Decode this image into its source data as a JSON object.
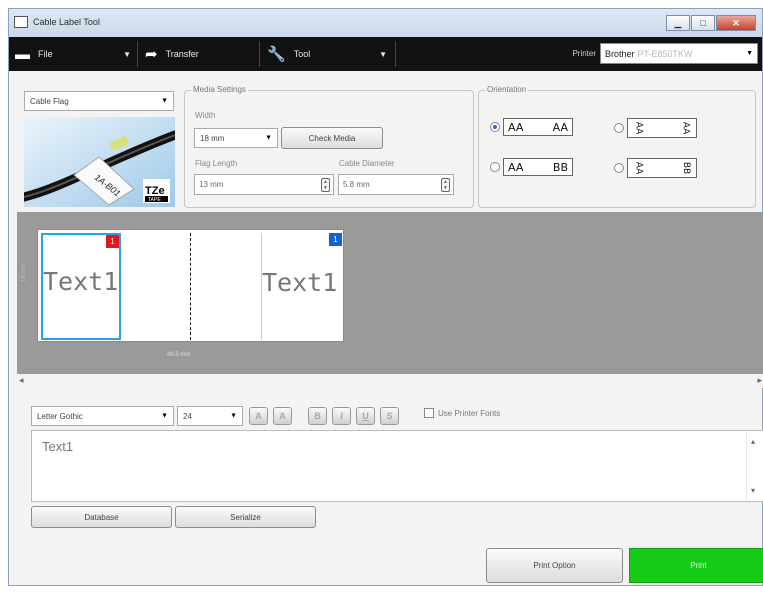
{
  "window": {
    "title": "Cable Label Tool",
    "controls": {
      "minimize": "▁",
      "maximize": "□",
      "close": "✕"
    }
  },
  "toolbar": {
    "file_label": "File",
    "transfer_label": "Transfer",
    "tool_label": "Tool",
    "printer_label": "Printer",
    "printer_value": "Brother",
    "printer_model": "PT-E850TKW"
  },
  "label_type": {
    "selected": "Cable Flag",
    "image_text": "1A-B01",
    "brand_mark": "TZe",
    "brand_sub": "TAPE"
  },
  "media_settings": {
    "group_label": "Media Settings",
    "width_label": "Width",
    "width_value": "18 mm",
    "check_media_label": "Check Media",
    "flag_length_label": "Flag Length",
    "flag_length_value": "13 mm",
    "cable_diameter_label": "Cable Diameter",
    "cable_diameter_value": "5.8 mm"
  },
  "orientation": {
    "group_label": "Orientation",
    "options": [
      {
        "left": "AA",
        "right": "AA",
        "selected": true,
        "rotated": false
      },
      {
        "left": "AA",
        "right": "AA",
        "selected": false,
        "rotated": true
      },
      {
        "left": "AA",
        "right": "BB",
        "selected": false,
        "rotated": false
      },
      {
        "left": "AA",
        "right": "BB",
        "selected": false,
        "rotated": true
      }
    ]
  },
  "preview": {
    "side_label": "18 mm",
    "cell1_text": "Text1",
    "cell2_text": "Text1",
    "badge1": "1",
    "badge2": "1",
    "badge1_color": "#e8141a",
    "badge2_color": "#1460d8",
    "length_label": "48.5 mm"
  },
  "format": {
    "font_name": "Letter Gothic",
    "font_size": "24",
    "buttons": [
      "A",
      "A",
      "B",
      "I",
      "U",
      "S"
    ],
    "use_printer_fonts_label": "Use Printer Fonts"
  },
  "editor": {
    "text": "Text1"
  },
  "actions": {
    "database_label": "Database",
    "serialize_label": "Serialize",
    "print_option_label": "Print Option",
    "print_label": "Print",
    "print_color": "#16cc16"
  },
  "scroll": {
    "left_arrow": "◂",
    "right_arrow": "▸",
    "up_arrow": "▴",
    "down_arrow": "▾"
  }
}
